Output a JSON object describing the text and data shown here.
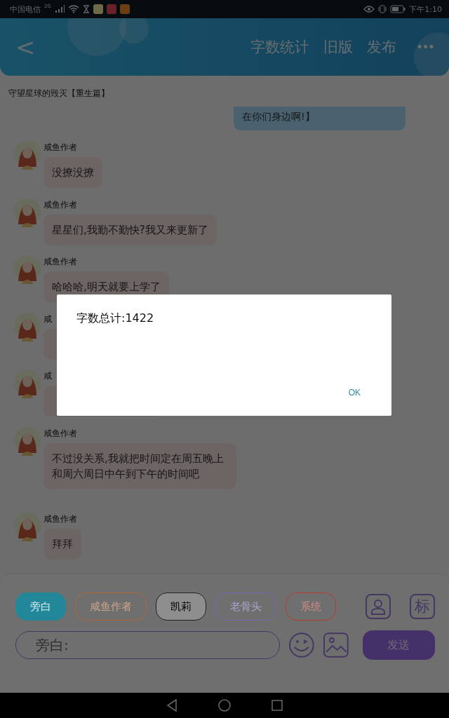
{
  "status_bar": {
    "carrier": "中国电信",
    "network": "2G",
    "time": "下午1:10"
  },
  "header": {
    "back": "<",
    "actions": [
      {
        "label": "字数统计"
      },
      {
        "label": "旧版"
      },
      {
        "label": "发布"
      }
    ],
    "more": "•••"
  },
  "title": "守望星球的毁灭【重生篇】",
  "messages": [
    {
      "kind": "right",
      "text": "在你们身边啊!】"
    },
    {
      "kind": "left",
      "sender": "咸鱼作者",
      "text": "没撩没撩"
    },
    {
      "kind": "left",
      "sender": "咸鱼作者",
      "text": "星星们,我勤不勤快?我又来更新了"
    },
    {
      "kind": "left",
      "sender": "咸鱼作者",
      "text": "哈哈哈,明天就要上学了"
    },
    {
      "kind": "covered",
      "sender": "咸"
    },
    {
      "kind": "covered",
      "sender": "咸"
    },
    {
      "kind": "left",
      "sender": "咸鱼作者",
      "text": "不过没关系,我就把时间定在周五晚上和周六周日中午到下午的时间吧"
    },
    {
      "kind": "left",
      "sender": "咸鱼作者",
      "text": "拜拜"
    }
  ],
  "roles": [
    {
      "label": "旁白",
      "color": "#23879a",
      "selected": true
    },
    {
      "label": "咸鱼作者",
      "color": "#b0683a",
      "selected": false
    },
    {
      "label": "凯莉",
      "color": "#222222",
      "selected": false
    },
    {
      "label": "老骨头",
      "color": "#7a64b0",
      "selected": false
    },
    {
      "label": "系统",
      "color": "#b83a32",
      "selected": false
    }
  ],
  "mark_button": "标",
  "input": {
    "placeholder": "旁白:"
  },
  "send": "发送",
  "dialog": {
    "message": "字数总计:1422",
    "button": "OK"
  }
}
